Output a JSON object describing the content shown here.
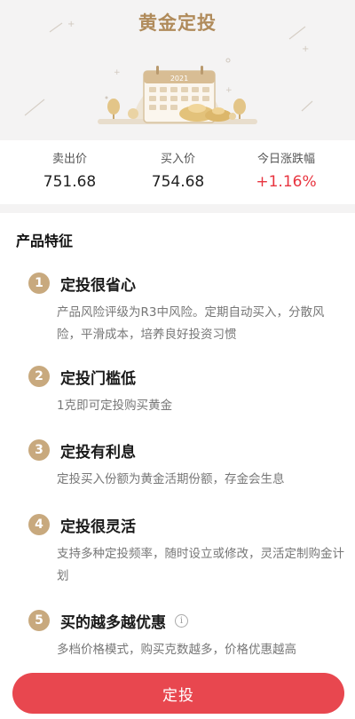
{
  "header": {
    "title": "黄金定投",
    "calendar_year": "2021"
  },
  "prices": [
    {
      "label": "卖出价",
      "value": "751.68",
      "up": false
    },
    {
      "label": "买入价",
      "value": "754.68",
      "up": false
    },
    {
      "label": "今日涨跌幅",
      "value": "+1.16%",
      "up": true
    }
  ],
  "section": {
    "title": "产品特征"
  },
  "features": [
    {
      "num": "1",
      "title": "定投很省心",
      "desc": "产品风险评级为R3中风险。定期自动买入，分散风险，平滑成本，培养良好投资习惯"
    },
    {
      "num": "2",
      "title": "定投门槛低",
      "desc": "1克即可定投购买黄金"
    },
    {
      "num": "3",
      "title": "定投有利息",
      "desc": "定投买入份额为黄金活期份额，存金会生息"
    },
    {
      "num": "4",
      "title": "定投很灵活",
      "desc": "支持多种定投频率，随时设立或修改，灵活定制购金计划"
    },
    {
      "num": "5",
      "title": "买的越多越优惠",
      "desc": "多档价格模式，购买克数越多，价格优惠越高",
      "info_icon": "i"
    }
  ],
  "cta": {
    "label": "定投"
  },
  "colors": {
    "gold": "#b08b5b",
    "badge": "#c8a97e",
    "up": "#e8343f",
    "button": "#e8474f"
  }
}
